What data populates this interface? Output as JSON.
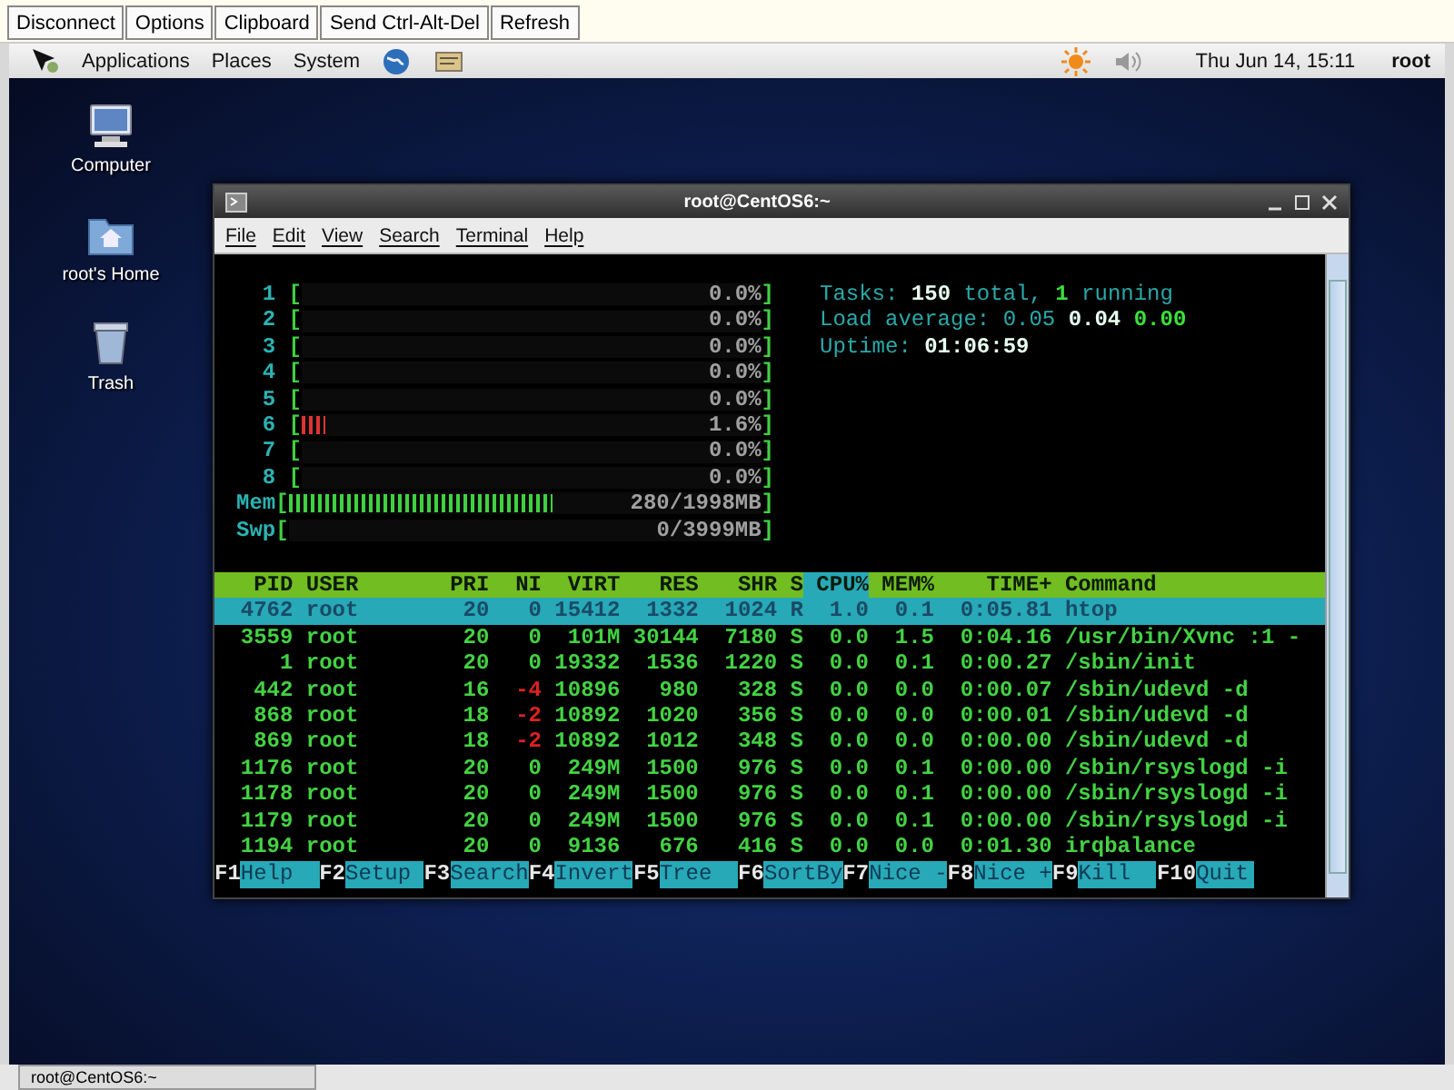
{
  "vnc_toolbar": {
    "buttons": [
      "Disconnect",
      "Options",
      "Clipboard",
      "Send Ctrl-Alt-Del",
      "Refresh"
    ]
  },
  "top_panel": {
    "menus": [
      "Applications",
      "Places",
      "System"
    ],
    "clock": "Thu Jun 14, 15:11",
    "user": "root"
  },
  "desktop_icons": [
    {
      "label": "Computer",
      "kind": "computer"
    },
    {
      "label": "root's Home",
      "kind": "home"
    },
    {
      "label": "Trash",
      "kind": "trash"
    }
  ],
  "terminal": {
    "title": "root@CentOS6:~",
    "menu": [
      "File",
      "Edit",
      "View",
      "Search",
      "Terminal",
      "Help"
    ],
    "htop": {
      "meter_brackets": [
        "[",
        "]"
      ],
      "cpus": [
        {
          "label": "1",
          "level": 0,
          "reading": "0.0%"
        },
        {
          "label": "2",
          "level": 0,
          "reading": "0.0%"
        },
        {
          "label": "3",
          "level": 0,
          "reading": "0.0%"
        },
        {
          "label": "4",
          "level": 0,
          "reading": "0.0%"
        },
        {
          "label": "5",
          "level": 0,
          "reading": "0.0%"
        },
        {
          "label": "6",
          "level": 0.05,
          "reading": "1.6%"
        },
        {
          "label": "7",
          "level": 0,
          "reading": "0.0%"
        },
        {
          "label": "8",
          "level": 0,
          "reading": "0.0%"
        }
      ],
      "memory": [
        {
          "label": "Mem",
          "level": 0.56,
          "reading": "280/1998MB"
        },
        {
          "label": "Swp",
          "level": 0,
          "reading": "0/3999MB"
        }
      ],
      "summary": [
        "Tasks: **150** total, **1** running",
        "Load average: 0.05 **0.04** **0.00**",
        "Uptime: **01:06:59**"
      ],
      "columns": [
        {
          "label": "PID",
          "selected": false
        },
        {
          "label": "USER",
          "selected": false
        },
        {
          "label": "PRI",
          "selected": false
        },
        {
          "label": "NI",
          "selected": false
        },
        {
          "label": "VIRT",
          "selected": false
        },
        {
          "label": "RES",
          "selected": false
        },
        {
          "label": "SHR",
          "selected": false
        },
        {
          "label": "S",
          "selected": false
        },
        {
          "label": "CPU%",
          "selected": true
        },
        {
          "label": "MEM%",
          "selected": false
        },
        {
          "label": "TIME+",
          "selected": false
        },
        {
          "label": "Command",
          "selected": false
        }
      ],
      "rows": [
        {
          "selected": true,
          "ni_negative": false,
          "cells": [
            "4762",
            "root",
            "20",
            "0",
            "15412",
            "1332",
            "1024",
            "R",
            "1.0",
            "0.1",
            "0:05.81",
            "htop"
          ]
        },
        {
          "selected": false,
          "ni_negative": false,
          "cells": [
            "3559",
            "root",
            "20",
            "0",
            "101M",
            "30144",
            "7180",
            "S",
            "0.0",
            "1.5",
            "0:04.16",
            "/usr/bin/Xvnc :1 -"
          ]
        },
        {
          "selected": false,
          "ni_negative": false,
          "cells": [
            "1",
            "root",
            "20",
            "0",
            "19332",
            "1536",
            "1220",
            "S",
            "0.0",
            "0.1",
            "0:00.27",
            "/sbin/init"
          ]
        },
        {
          "selected": false,
          "ni_negative": true,
          "cells": [
            "442",
            "root",
            "16",
            "-4",
            "10896",
            "980",
            "328",
            "S",
            "0.0",
            "0.0",
            "0:00.07",
            "/sbin/udevd -d"
          ]
        },
        {
          "selected": false,
          "ni_negative": true,
          "cells": [
            "868",
            "root",
            "18",
            "-2",
            "10892",
            "1020",
            "356",
            "S",
            "0.0",
            "0.0",
            "0:00.01",
            "/sbin/udevd -d"
          ]
        },
        {
          "selected": false,
          "ni_negative": true,
          "cells": [
            "869",
            "root",
            "18",
            "-2",
            "10892",
            "1012",
            "348",
            "S",
            "0.0",
            "0.0",
            "0:00.00",
            "/sbin/udevd -d"
          ]
        },
        {
          "selected": false,
          "ni_negative": false,
          "cells": [
            "1176",
            "root",
            "20",
            "0",
            "249M",
            "1500",
            "976",
            "S",
            "0.0",
            "0.1",
            "0:00.00",
            "/sbin/rsyslogd -i"
          ]
        },
        {
          "selected": false,
          "ni_negative": false,
          "cells": [
            "1178",
            "root",
            "20",
            "0",
            "249M",
            "1500",
            "976",
            "S",
            "0.0",
            "0.1",
            "0:00.00",
            "/sbin/rsyslogd -i"
          ]
        },
        {
          "selected": false,
          "ni_negative": false,
          "cells": [
            "1179",
            "root",
            "20",
            "0",
            "249M",
            "1500",
            "976",
            "S",
            "0.0",
            "0.1",
            "0:00.00",
            "/sbin/rsyslogd -i"
          ]
        },
        {
          "selected": false,
          "ni_negative": false,
          "cells": [
            "1194",
            "root",
            "20",
            "0",
            "9136",
            "676",
            "416",
            "S",
            "0.0",
            "0.0",
            "0:01.30",
            "irqbalance"
          ]
        }
      ],
      "function_keys": [
        {
          "key": "F1",
          "label": "Help"
        },
        {
          "key": "F2",
          "label": "Setup"
        },
        {
          "key": "F3",
          "label": "Search"
        },
        {
          "key": "F4",
          "label": "Invert"
        },
        {
          "key": "F5",
          "label": "Tree"
        },
        {
          "key": "F6",
          "label": "SortBy"
        },
        {
          "key": "F7",
          "label": "Nice -"
        },
        {
          "key": "F8",
          "label": "Nice +"
        },
        {
          "key": "F9",
          "label": "Kill"
        },
        {
          "key": "F10",
          "label": "Quit"
        }
      ]
    }
  },
  "taskbar": {
    "windows": [
      "root@CentOS6:~"
    ]
  }
}
